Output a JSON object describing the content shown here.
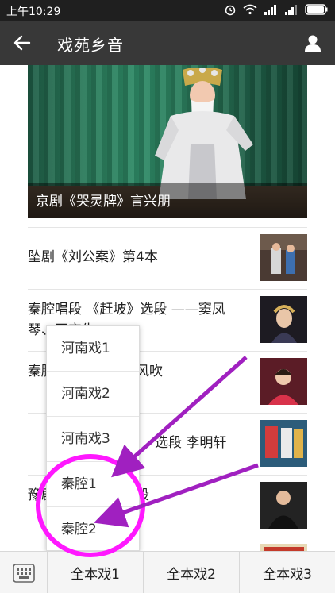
{
  "status": {
    "time": "上午10:29"
  },
  "header": {
    "title": "戏苑乡音"
  },
  "hero": {
    "caption": "京剧《哭灵牌》言兴朋"
  },
  "articles": [
    {
      "title": "坠剧《刘公案》第4本"
    },
    {
      "title": "秦腔唱段 《赶坡》选段 ——窦凤琴、王宝生"
    },
    {
      "title": "秦腔《赤卫队》秋风吹"
    },
    {
      "title": "选段 李明轩"
    },
    {
      "title": "豫剧《》老父亲唱段"
    },
    {
      "title": ""
    }
  ],
  "popup": {
    "options": [
      "河南戏1",
      "河南戏2",
      "河南戏3",
      "秦腔1",
      "秦腔2"
    ]
  },
  "bottom_menu": {
    "items": [
      "全本戏1",
      "全本戏2",
      "全本戏3"
    ]
  },
  "colors": {
    "annotation": "#cc00cc",
    "arrow": "#a020c0",
    "titlebar": "#383838",
    "statusbar": "#1f1f1f"
  }
}
